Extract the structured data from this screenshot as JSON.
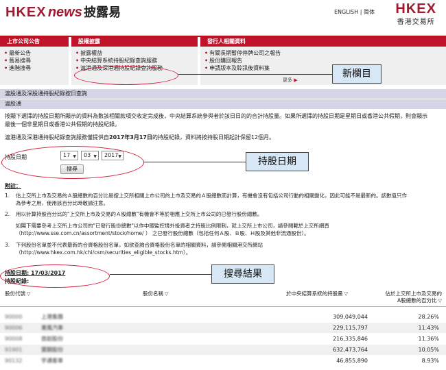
{
  "header": {
    "logo_hkex": "HKEX",
    "logo_news": "news",
    "logo_cn": "披露易",
    "lang_en": "ENGLISH",
    "lang_sep": "|",
    "lang_cn": "简体",
    "brand_en": "HKEX",
    "brand_cn": "香港交易所"
  },
  "menu": [
    {
      "title": "上市公司公告",
      "items": [
        "最新公告",
        "舊易搜尋",
        "進階搜尋"
      ]
    },
    {
      "title": "股權披露",
      "items": [
        "披露權益",
        "中央結算系統持股紀錄查詢服務",
        "滬港通及深港通持股紀錄查詢服務"
      ]
    },
    {
      "title": "發行人相關資料",
      "items": [
        "有關長期暫停停牌公司之報告",
        "股份購回報告",
        "申請版本及聆訊後資料集"
      ]
    }
  ],
  "more_label": "更多",
  "section": {
    "title": "滬股通及深股通持股紀錄按日查詢",
    "subtitle": "滬股通"
  },
  "intro": {
    "line1": "按顯下選擇的持股日期所顯示的資料為數該相關款項交收定完成後，中央結算系統參與者於該日日的的合計持股量。如果所選擇的持股日期是星期日或香港公共假期，則會顯示",
    "line2": "最後一個非星期日或香港公共假期的持股紀錄。",
    "line3_pre": "滬港通及深港通持股紀錄查詢服務僅提供自",
    "line3_date": "2017年3月17日",
    "line3_post": "的持股紀錄，資料將按持股日期起計保留12個月。"
  },
  "form": {
    "label": "持股日期",
    "day": "17",
    "month": "03",
    "year": "2017",
    "search_label": "搜尋"
  },
  "notes": {
    "title": "附註：",
    "items": [
      {
        "num": "1.",
        "lines": [
          "估上交所上市及交易的Ａ股總數的百分比是按上交所相關上市公司的上市及交易的Ａ股總數而計算，有機會沒有包括公司行動的相關變化，因此可能不是最新的。該數值只作",
          "為參考之用，使用該百分比時敬請注意。"
        ]
      },
      {
        "num": "2.",
        "lines": [
          "用以計算持股百分比的\"上交所上市及交易的Ａ股總數\"有機會不等於相應上交所上市公司的已發行股份總數。",
          "",
          "如閣下需要參考上交所上市公司的\"已發行股份總數\"以作中國監控境外投資者之持股比例限制，就上交所上市公司，請參閱載於上交所網頁",
          "（http://www.sse.com.cn/assortment/stock/home/ ） 之已發行股份總數（包括任何Ａ股、Ｂ股、Ｈ股及其他非流通股份）。"
        ]
      },
      {
        "num": "3.",
        "lines": [
          "下列股份名單並不代表最新的合資格股份名單，如欲查詢合資格股份名單的相關資料，請參閱相關港交所網站",
          "（http://www.hkex.com.hk/chi/csm/securities_eligible_stocks.htm）。"
        ]
      }
    ]
  },
  "result": {
    "date_label": "持股日期: 17/03/2017",
    "category_label": "持股紀錄:"
  },
  "table": {
    "headers": {
      "code": "股份代號",
      "name": "股份名稱",
      "shares": "於中央結算系統的持股量",
      "pct_line1": "佔於上交所上市及交易的",
      "pct_line2": "A股總數的百分比"
    },
    "rows": [
      {
        "code": "90000",
        "name": "上港集團",
        "shares": "309,049,044",
        "pct": "28.26%"
      },
      {
        "code": "90006",
        "name": "東風汽車",
        "shares": "229,115,797",
        "pct": "11.43%"
      },
      {
        "code": "90008",
        "name": "首創股份",
        "shares": "216,335,846",
        "pct": "11.36%"
      },
      {
        "code": "91901",
        "name": "寶鋼股份",
        "shares": "632,473,764",
        "pct": "10.05%"
      },
      {
        "code": "90132",
        "name": "宇通客車",
        "shares": "46,855,890",
        "pct": "8.93%"
      }
    ]
  },
  "callouts": {
    "new_column": "新欄目",
    "holding_date": "持股日期",
    "search_result": "搜尋結果"
  },
  "colors": {
    "brand_red": "#c1142a",
    "section_bar": "#d5d5e6",
    "callout_fill": "#d8e7f5",
    "ellipse_red": "#d21b3a"
  }
}
